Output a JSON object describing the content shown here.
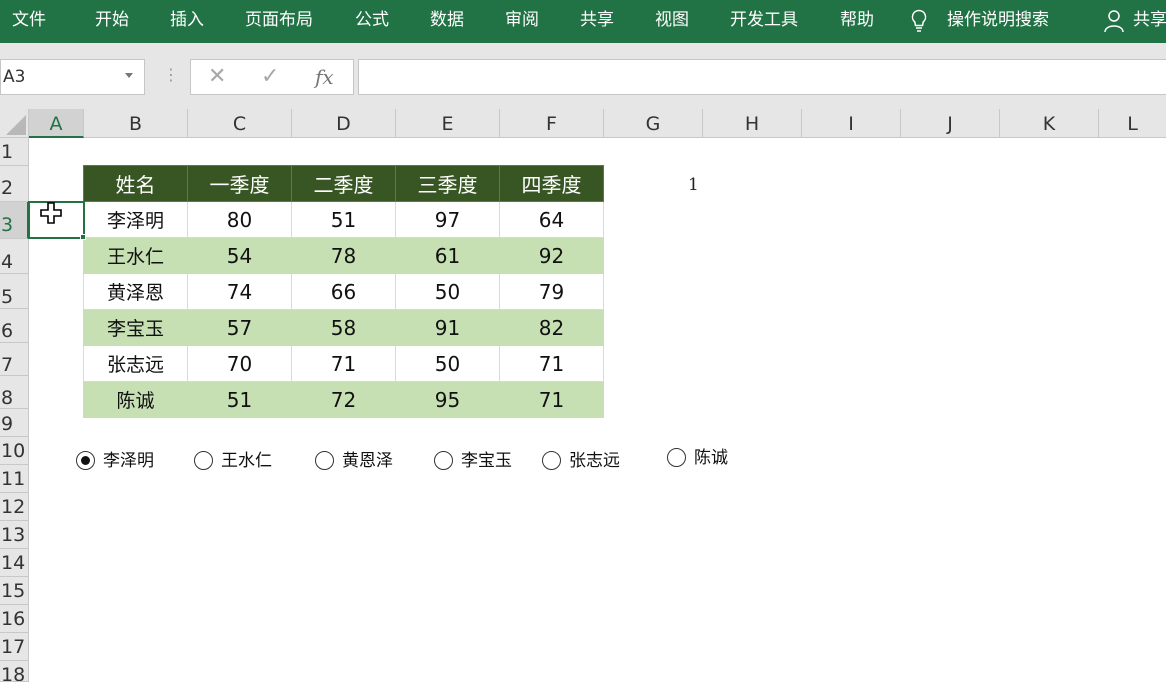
{
  "ribbon": {
    "tabs": [
      "文件",
      "开始",
      "插入",
      "页面布局",
      "公式",
      "数据",
      "审阅",
      "共享",
      "视图",
      "开发工具",
      "帮助"
    ],
    "tell_me": "操作说明搜索",
    "share": "共享",
    "icons": [
      "lightbulb-icon",
      "person-icon"
    ],
    "color": "#217346"
  },
  "formula_bar": {
    "name_box": "A3",
    "cancel_symbol": "✕",
    "enter_symbol": "✓",
    "fx_symbol": "fx",
    "formula": ""
  },
  "grid": {
    "columns": [
      "A",
      "B",
      "C",
      "D",
      "E",
      "F",
      "G",
      "H",
      "I",
      "J",
      "K",
      "L"
    ],
    "rows": [
      "1",
      "2",
      "3",
      "4",
      "5",
      "6",
      "7",
      "8",
      "9",
      "10",
      "11",
      "12",
      "13",
      "14",
      "15",
      "16",
      "17",
      "18"
    ],
    "selected_cell": "A3",
    "g2_value": "1"
  },
  "table": {
    "headers": [
      "姓名",
      "一季度",
      "二季度",
      "三季度",
      "四季度"
    ],
    "rows": [
      [
        "李泽明",
        "80",
        "51",
        "97",
        "64"
      ],
      [
        "王水仁",
        "54",
        "78",
        "61",
        "92"
      ],
      [
        "黄泽恩",
        "74",
        "66",
        "50",
        "79"
      ],
      [
        "李宝玉",
        "57",
        "58",
        "91",
        "82"
      ],
      [
        "张志远",
        "70",
        "71",
        "50",
        "71"
      ],
      [
        "陈诚",
        "51",
        "72",
        "95",
        "71"
      ]
    ],
    "header_color": "#375623",
    "band_color": "#c6e0b4"
  },
  "options": {
    "items": [
      "李泽明",
      "王水仁",
      "黄恩泽",
      "李宝玉",
      "张志远",
      "陈诚"
    ],
    "selected_index": 0
  }
}
